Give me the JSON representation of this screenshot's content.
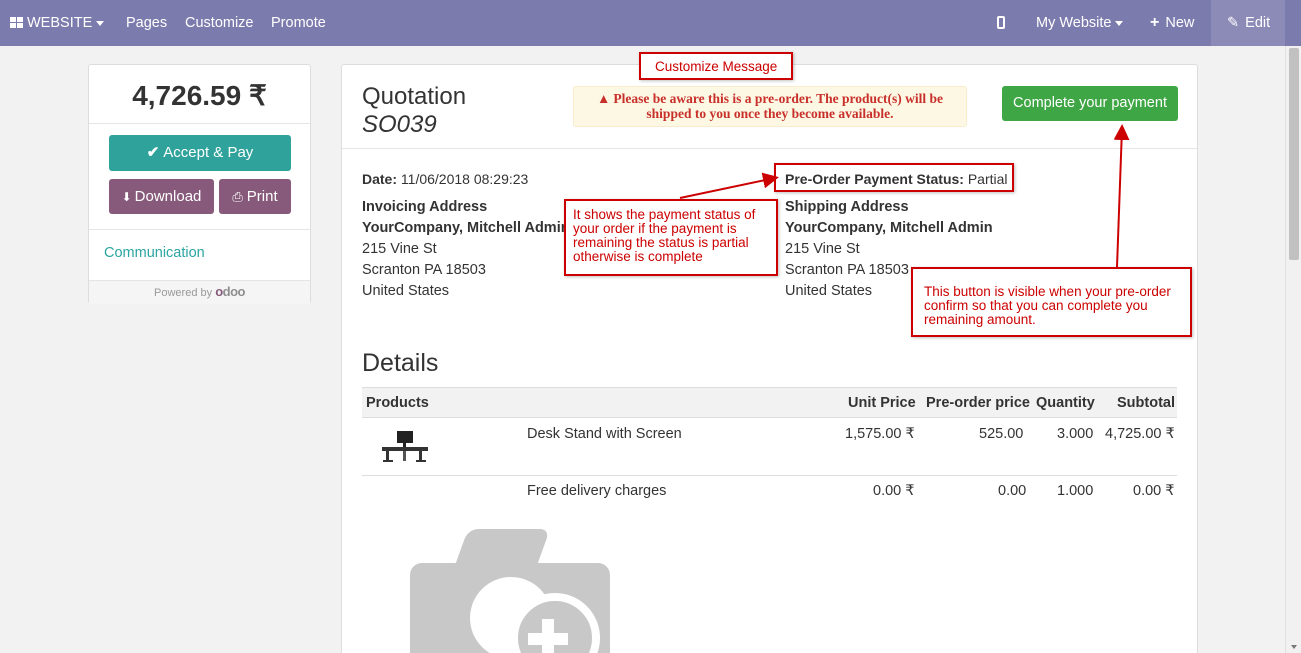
{
  "navbar": {
    "website_label": "WEBSITE",
    "pages": "Pages",
    "customize": "Customize",
    "promote": "Promote",
    "my_website": "My Website",
    "new": "New",
    "edit": "Edit"
  },
  "sidebar": {
    "amount": "4,726.59 ₹",
    "accept_pay": "Accept & Pay",
    "download": "Download",
    "print": "Print",
    "communication": "Communication",
    "powered_by": "Powered by"
  },
  "quotation": {
    "title": "Quotation",
    "number": "SO039",
    "alert_line1": "Please be aware this is a pre-order. The product(s) will be",
    "alert_line2": "shipped to you once they become available.",
    "complete_payment": "Complete your payment",
    "date_label": "Date:",
    "date_value": "11/06/2018 08:29:23",
    "payment_status_label": "Pre-Order Payment Status:",
    "payment_status_value": "Partial"
  },
  "invoicing_address": {
    "heading": "Invoicing Address",
    "name": "YourCompany, Mitchell Admin",
    "street": "215 Vine St",
    "city": "Scranton PA 18503",
    "country": "United States"
  },
  "shipping_address": {
    "heading": "Shipping Address",
    "name": "YourCompany, Mitchell Admin",
    "street": "215 Vine St",
    "city": "Scranton PA 18503",
    "country": "United States"
  },
  "details": {
    "title": "Details",
    "columns": {
      "products": "Products",
      "unit_price": "Unit Price",
      "preorder_price": "Pre-order price",
      "quantity": "Quantity",
      "subtotal": "Subtotal"
    },
    "rows": [
      {
        "name": "Desk Stand with Screen",
        "unit_price": "1,575.00 ₹",
        "preorder_price": "525.00",
        "quantity": "3.000",
        "subtotal": "4,725.00 ₹"
      },
      {
        "name": "Free delivery charges",
        "unit_price": "0.00 ₹",
        "preorder_price": "0.00",
        "quantity": "1.000",
        "subtotal": "0.00 ₹"
      }
    ]
  },
  "annotations": {
    "customize_message": "Customize Message",
    "status_note_line1": "It shows the payment status of",
    "status_note_line2": "your order if the payment is",
    "status_note_line3": "remaining the status is partial",
    "status_note_line4": "otherwise is complete",
    "button_note_line1": "This button is visible when your pre-order",
    "button_note_line2": "confirm so that you can complete you",
    "button_note_line3": "remaining amount."
  },
  "colors": {
    "navbar": "#7c7bad",
    "accept_button": "#2fa39b",
    "secondary_button": "#875a7b",
    "complete_button": "#3fa645",
    "annotation_red": "#cc0000"
  }
}
